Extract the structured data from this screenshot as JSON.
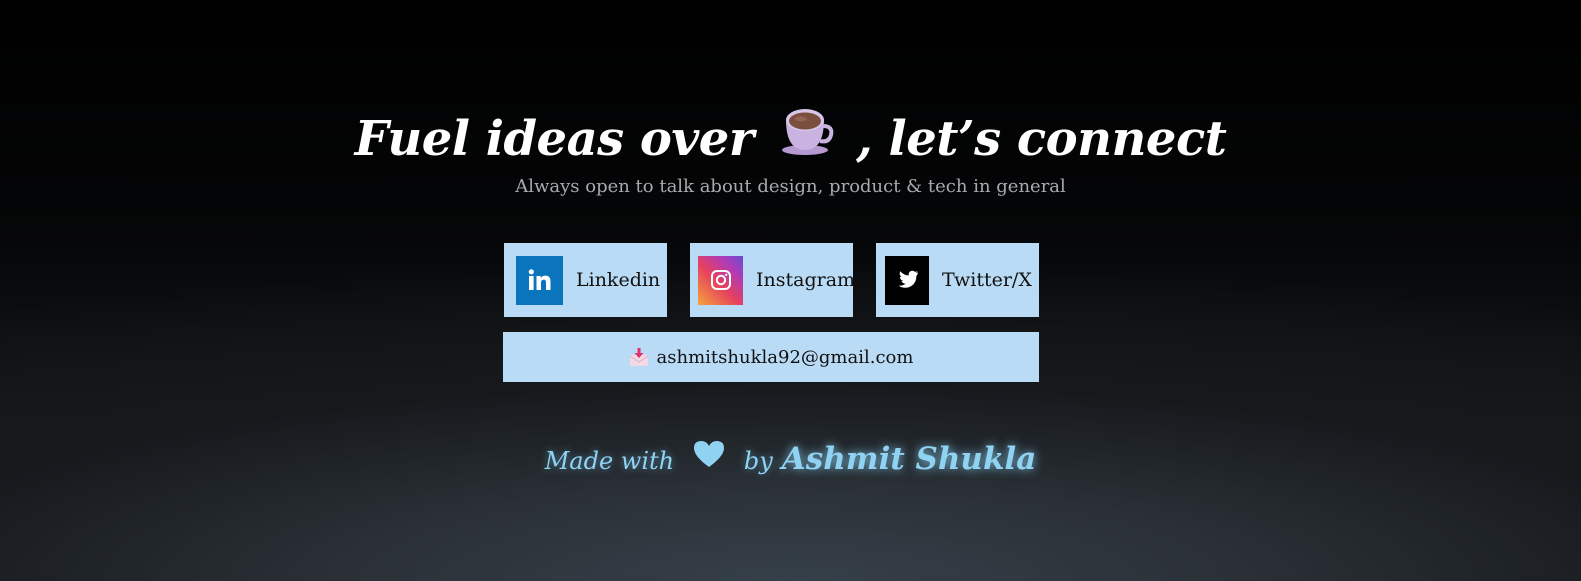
{
  "hero": {
    "title_before": "Fuel ideas over",
    "title_after": ", let’s connect",
    "title_icon": "coffee-cup-icon",
    "subtitle": "Always open to talk about design, product & tech in general"
  },
  "socials": [
    {
      "label": "Linkedin",
      "icon": "linkedin-icon",
      "color": "#0a75bd"
    },
    {
      "label": "Instagram",
      "icon": "instagram-icon",
      "color": "#e6405f"
    },
    {
      "label": "Twitter/X",
      "icon": "twitter-icon",
      "color": "#000000"
    }
  ],
  "email": {
    "address": "ashmitshukla92@gmail.com",
    "icon": "mail-download-icon"
  },
  "footer": {
    "made_with": "Made with",
    "heart_icon": "heart-icon",
    "by": "by",
    "author": "Ashmit Shukla"
  },
  "colors": {
    "card_background": "#b9dbf5",
    "footer_text": "#8fd2f2",
    "subtitle_text": "#a9aaac"
  }
}
